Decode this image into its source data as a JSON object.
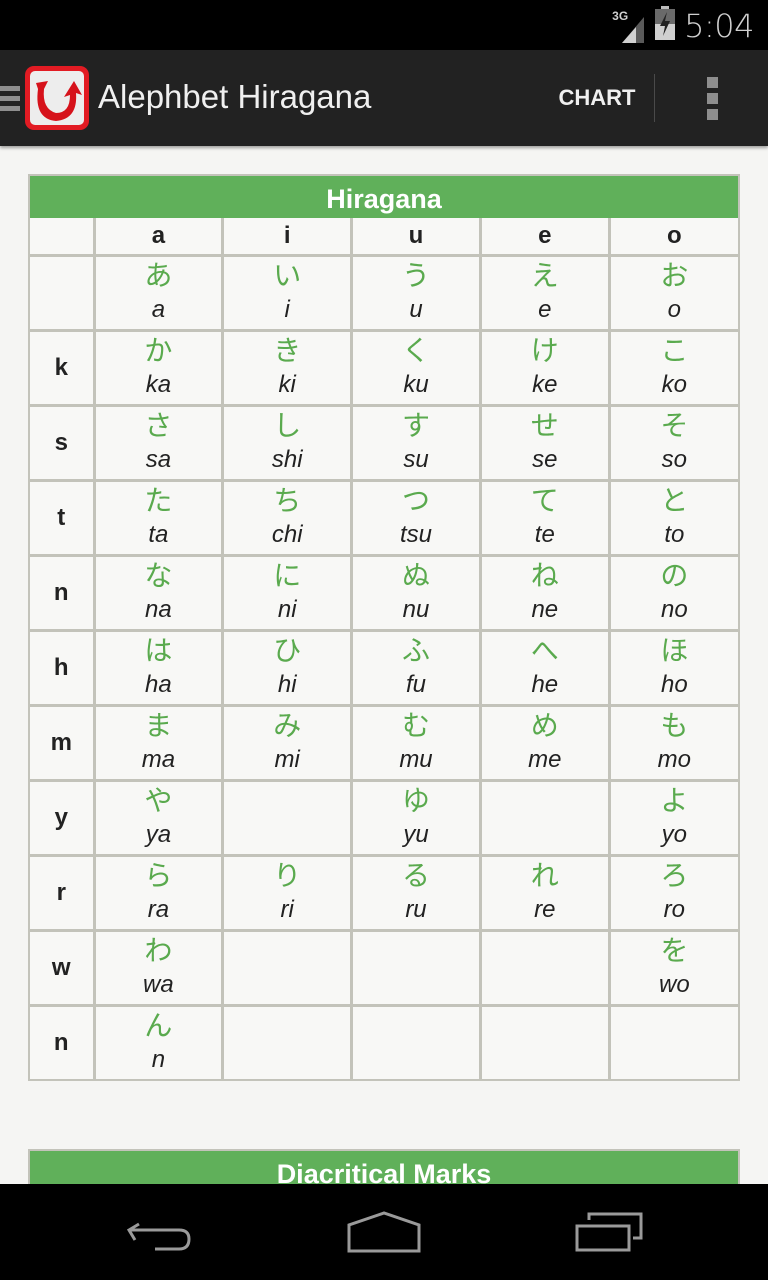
{
  "status_bar": {
    "network": "3G",
    "time": "5:04"
  },
  "action_bar": {
    "title": "Alephbet Hiragana",
    "logo_glyph": "ひ",
    "chart_label": "CHART",
    "icons": [
      "drawer-menu-icon",
      "app-logo",
      "overflow-menu-icon"
    ]
  },
  "colors": {
    "accent_green": "#60b05a",
    "kana_green": "#5aaa4e",
    "logo_red": "#e21b23",
    "action_bar": "#222222"
  },
  "hiragana_table": {
    "title": "Hiragana",
    "columns": [
      "a",
      "i",
      "u",
      "e",
      "o"
    ],
    "rows": [
      {
        "label": "",
        "cells": [
          {
            "kana": "あ",
            "romaji": "a"
          },
          {
            "kana": "い",
            "romaji": "i"
          },
          {
            "kana": "う",
            "romaji": "u"
          },
          {
            "kana": "え",
            "romaji": "e"
          },
          {
            "kana": "お",
            "romaji": "o"
          }
        ]
      },
      {
        "label": "k",
        "cells": [
          {
            "kana": "か",
            "romaji": "ka"
          },
          {
            "kana": "き",
            "romaji": "ki"
          },
          {
            "kana": "く",
            "romaji": "ku"
          },
          {
            "kana": "け",
            "romaji": "ke"
          },
          {
            "kana": "こ",
            "romaji": "ko"
          }
        ]
      },
      {
        "label": "s",
        "cells": [
          {
            "kana": "さ",
            "romaji": "sa"
          },
          {
            "kana": "し",
            "romaji": "shi"
          },
          {
            "kana": "す",
            "romaji": "su"
          },
          {
            "kana": "せ",
            "romaji": "se"
          },
          {
            "kana": "そ",
            "romaji": "so"
          }
        ]
      },
      {
        "label": "t",
        "cells": [
          {
            "kana": "た",
            "romaji": "ta"
          },
          {
            "kana": "ち",
            "romaji": "chi"
          },
          {
            "kana": "つ",
            "romaji": "tsu"
          },
          {
            "kana": "て",
            "romaji": "te"
          },
          {
            "kana": "と",
            "romaji": "to"
          }
        ]
      },
      {
        "label": "n",
        "cells": [
          {
            "kana": "な",
            "romaji": "na"
          },
          {
            "kana": "に",
            "romaji": "ni"
          },
          {
            "kana": "ぬ",
            "romaji": "nu"
          },
          {
            "kana": "ね",
            "romaji": "ne"
          },
          {
            "kana": "の",
            "romaji": "no"
          }
        ]
      },
      {
        "label": "h",
        "cells": [
          {
            "kana": "は",
            "romaji": "ha"
          },
          {
            "kana": "ひ",
            "romaji": "hi"
          },
          {
            "kana": "ふ",
            "romaji": "fu"
          },
          {
            "kana": "へ",
            "romaji": "he"
          },
          {
            "kana": "ほ",
            "romaji": "ho"
          }
        ]
      },
      {
        "label": "m",
        "cells": [
          {
            "kana": "ま",
            "romaji": "ma"
          },
          {
            "kana": "み",
            "romaji": "mi"
          },
          {
            "kana": "む",
            "romaji": "mu"
          },
          {
            "kana": "め",
            "romaji": "me"
          },
          {
            "kana": "も",
            "romaji": "mo"
          }
        ]
      },
      {
        "label": "y",
        "cells": [
          {
            "kana": "や",
            "romaji": "ya"
          },
          {
            "kana": "",
            "romaji": ""
          },
          {
            "kana": "ゆ",
            "romaji": "yu"
          },
          {
            "kana": "",
            "romaji": ""
          },
          {
            "kana": "よ",
            "romaji": "yo"
          }
        ]
      },
      {
        "label": "r",
        "cells": [
          {
            "kana": "ら",
            "romaji": "ra"
          },
          {
            "kana": "り",
            "romaji": "ri"
          },
          {
            "kana": "る",
            "romaji": "ru"
          },
          {
            "kana": "れ",
            "romaji": "re"
          },
          {
            "kana": "ろ",
            "romaji": "ro"
          }
        ]
      },
      {
        "label": "w",
        "cells": [
          {
            "kana": "わ",
            "romaji": "wa"
          },
          {
            "kana": "",
            "romaji": ""
          },
          {
            "kana": "",
            "romaji": ""
          },
          {
            "kana": "",
            "romaji": ""
          },
          {
            "kana": "を",
            "romaji": "wo"
          }
        ]
      },
      {
        "label": "n",
        "cells": [
          {
            "kana": "ん",
            "romaji": "n"
          },
          {
            "kana": "",
            "romaji": ""
          },
          {
            "kana": "",
            "romaji": ""
          },
          {
            "kana": "",
            "romaji": ""
          },
          {
            "kana": "",
            "romaji": ""
          }
        ]
      }
    ]
  },
  "diacritical_section": {
    "title": "Diacritical Marks"
  },
  "nav_bar": {
    "buttons": [
      "back",
      "home",
      "recents"
    ]
  }
}
